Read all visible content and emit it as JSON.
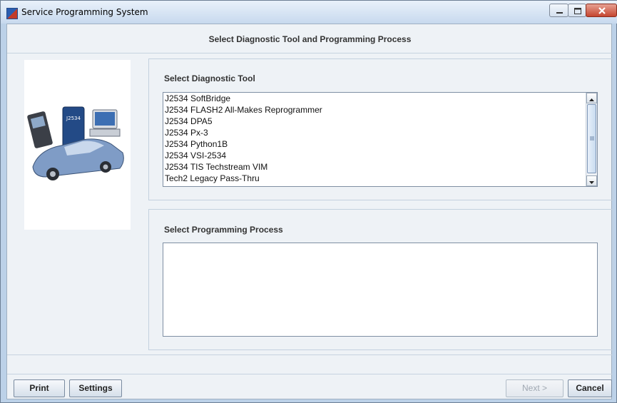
{
  "window": {
    "title": "Service Programming System"
  },
  "header": {
    "title": "Select Diagnostic Tool and Programming Process"
  },
  "diagnostic_tool": {
    "label": "Select Diagnostic Tool",
    "items": [
      "J2534 SoftBridge",
      "J2534 FLASH2 All-Makes Reprogrammer",
      "J2534 DPA5",
      "J2534 Px-3",
      "J2534 Python1B",
      "J2534 VSI-2534",
      "J2534 TIS Techstream VIM",
      "Tech2 Legacy Pass-Thru"
    ]
  },
  "programming_process": {
    "label": "Select Programming Process",
    "items": []
  },
  "image_panel": {
    "device_label": "J2534"
  },
  "buttons": {
    "print": "Print",
    "settings": "Settings",
    "next": "Next >",
    "cancel": "Cancel"
  },
  "colors": {
    "accent_bold_text": "#333333",
    "disabled_text": "#a0a8b2",
    "close_button": "#c5452f"
  }
}
